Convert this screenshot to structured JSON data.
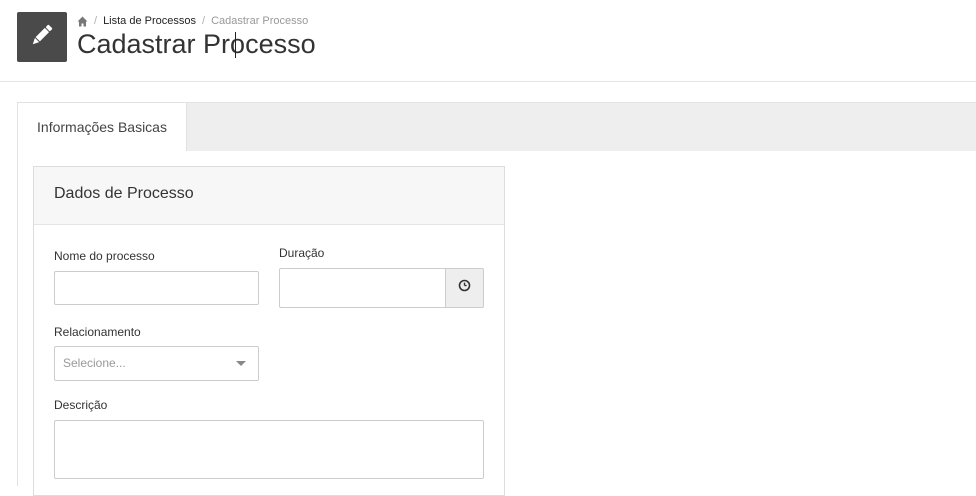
{
  "breadcrumb": {
    "home_icon": "home-icon",
    "separator": "/",
    "items": [
      "Lista de Processos",
      "Cadastrar Processo"
    ]
  },
  "header": {
    "icon": "pencil-icon",
    "title": "Cadastrar Processo"
  },
  "tabs": [
    {
      "label": "Informações Basicas",
      "active": true
    }
  ],
  "panel": {
    "title": "Dados de Processo"
  },
  "form": {
    "nome_label": "Nome do processo",
    "nome_value": "",
    "duracao_label": "Duração",
    "duracao_value": "",
    "duracao_icon": "clock-icon",
    "relacionamento_label": "Relacionamento",
    "relacionamento_placeholder": "Selecione...",
    "descricao_label": "Descrição",
    "descricao_value": ""
  },
  "colors": {
    "header_icon_bg": "#4a4a4a",
    "tabs_bar_bg": "#eeeeee",
    "panel_heading_bg": "#f7f7f7"
  }
}
